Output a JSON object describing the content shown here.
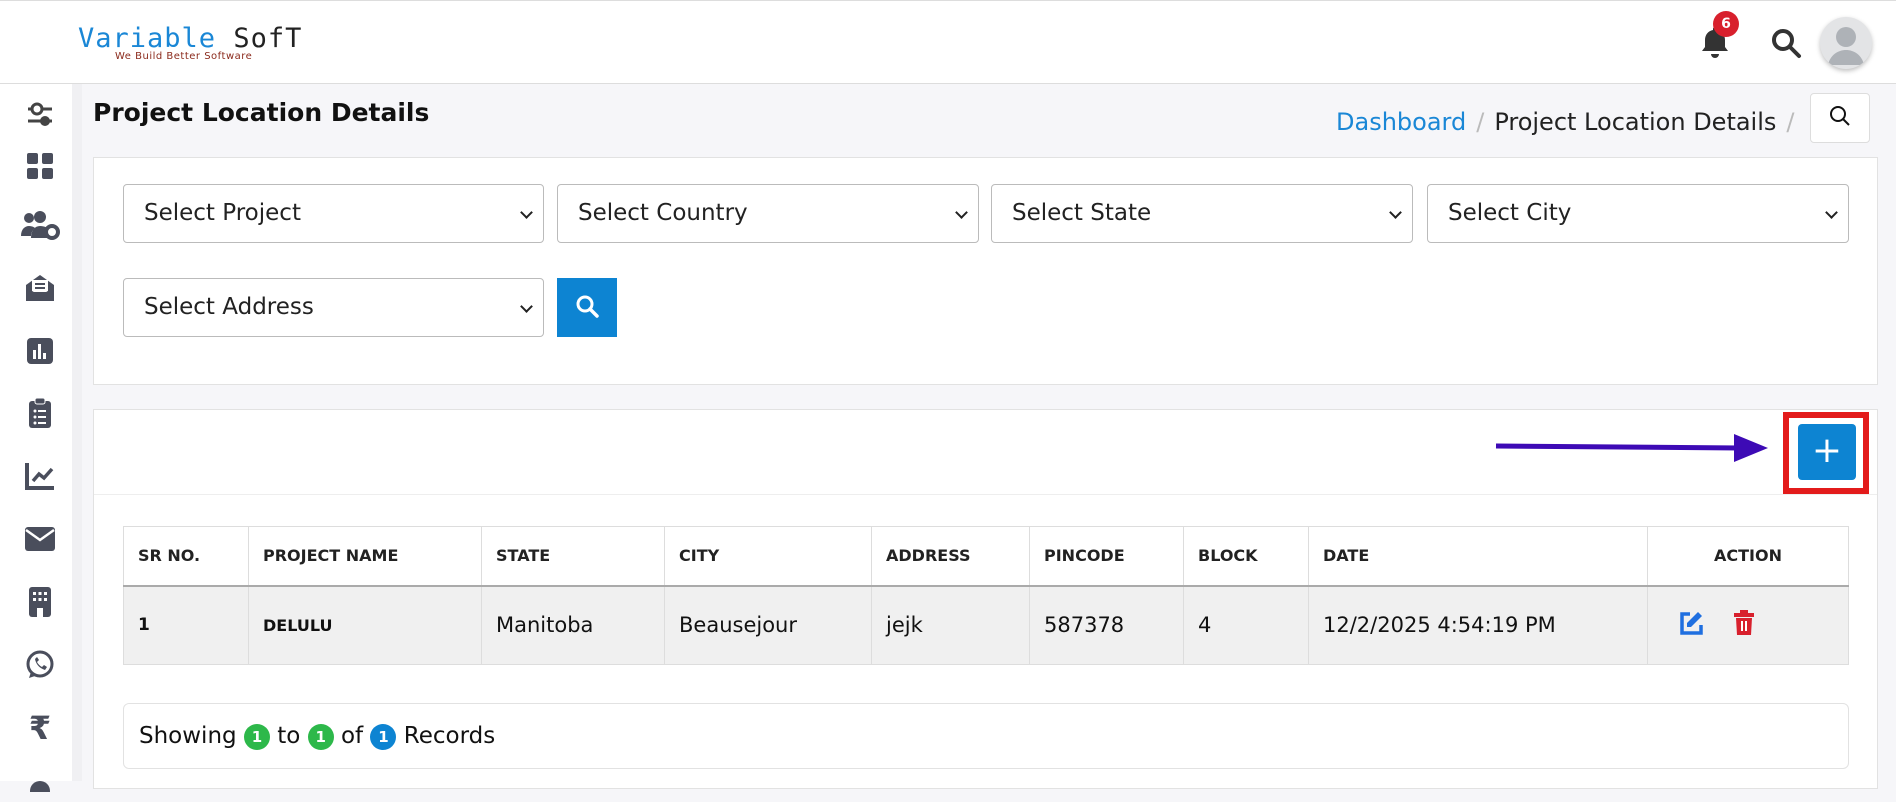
{
  "header": {
    "logo_main": "Variable",
    "logo_accent": "SofT",
    "logo_tagline": "We Build Better Software",
    "notification_count": "6"
  },
  "sidebar": {
    "items": [
      "filters",
      "dashboard",
      "users-settings",
      "mail-open",
      "reports",
      "clipboard",
      "analytics",
      "email",
      "building",
      "whatsapp",
      "rupee",
      "location"
    ]
  },
  "page": {
    "title": "Project Location Details",
    "breadcrumb": [
      "Dashboard",
      "Project Location Details"
    ],
    "breadcrumb_sep": "/"
  },
  "filters": {
    "project": "Select Project",
    "country": "Select Country",
    "state": "Select State",
    "city": "Select City",
    "address": "Select Address"
  },
  "add_button": "+",
  "table": {
    "headers": [
      "SR NO.",
      "PROJECT NAME",
      "STATE",
      "CITY",
      "ADDRESS",
      "PINCODE",
      "BLOCK",
      "DATE",
      "ACTION"
    ],
    "rows": [
      [
        "1",
        "DELULU",
        "Manitoba",
        "Beausejour",
        "jejk",
        "587378",
        "4",
        "12/2/2025 4:54:19 PM"
      ]
    ]
  },
  "footer": {
    "showing": "Showing",
    "from": "1",
    "to_label": "to",
    "to": "1",
    "of_label": "of",
    "total": "1",
    "records": "Records"
  },
  "colors": {
    "primary": "#0d84d2",
    "danger": "#d8202d",
    "green": "#2db84a",
    "arrow": "#3d0ab5"
  }
}
